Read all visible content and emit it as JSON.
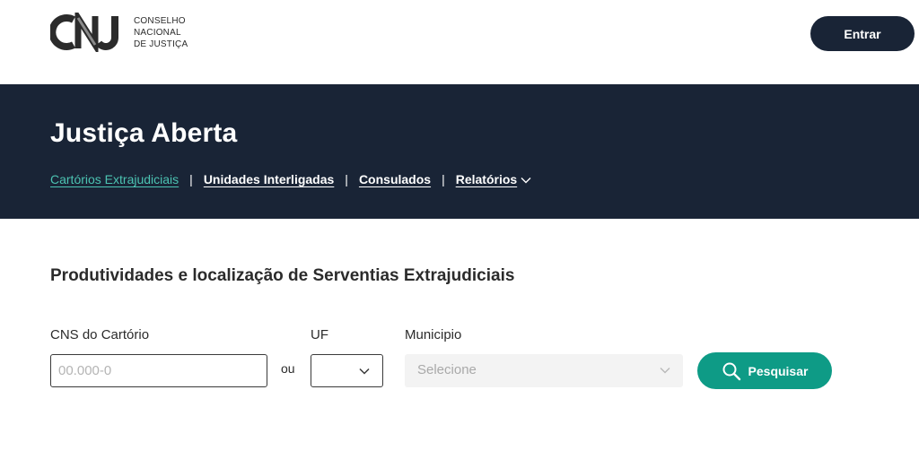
{
  "header": {
    "logo_letters": "CNJ",
    "logo_lines": [
      "CONSELHO",
      "NACIONAL",
      "DE JUSTIÇA"
    ],
    "login_label": "Entrar",
    "logo_colors": {
      "c": "#2b2b2b",
      "n": "#2b2b2b",
      "j": "#2b2b2b",
      "accent": "#8a8a8a"
    }
  },
  "band": {
    "title": "Justiça Aberta",
    "background": "#192436",
    "nav": [
      {
        "label": "Cartórios Extrajudiciais",
        "active": true
      },
      {
        "label": "Unidades Interligadas",
        "active": false
      },
      {
        "label": "Consulados",
        "active": false
      },
      {
        "label": "Relatórios",
        "active": false,
        "icon": "chevron-down-icon"
      }
    ],
    "separator": "|",
    "active_color": "#4cc3b2"
  },
  "main": {
    "title": "Produtividades e localização de Serventias Extrajudiciais",
    "cns_label": "CNS do Cartório",
    "cns_placeholder": "00.000-0",
    "cns_value": "",
    "or_text": "ou",
    "uf_label": "UF",
    "uf_value": "",
    "municipio_label": "Municipio",
    "municipio_placeholder": "Selecione",
    "search_label": "Pesquisar",
    "search_icon": "search-icon",
    "search_color": "#0e9b86"
  }
}
